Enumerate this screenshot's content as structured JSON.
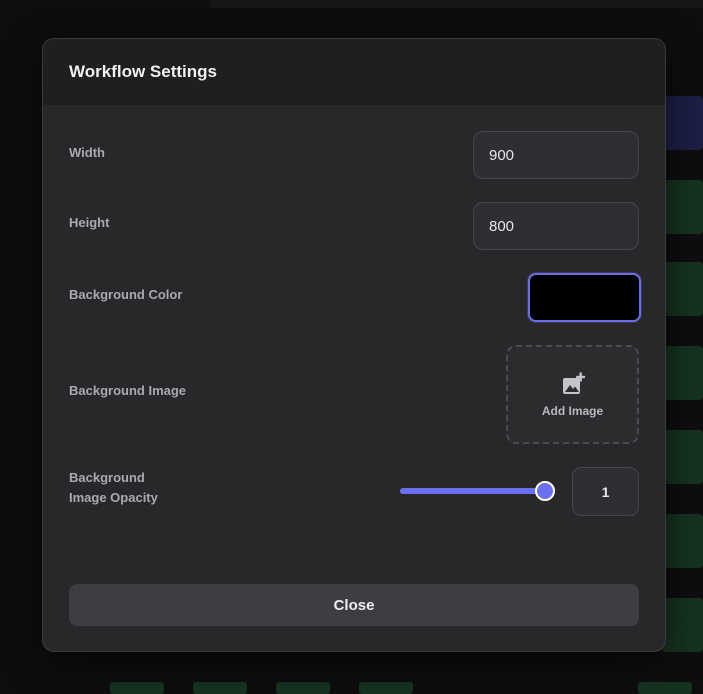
{
  "modal": {
    "title": "Workflow Settings",
    "width": {
      "label": "Width",
      "value": "900"
    },
    "height": {
      "label": "Height",
      "value": "800"
    },
    "background_color": {
      "label": "Background Color",
      "value": "#000000"
    },
    "background_image": {
      "label": "Background Image",
      "button_label": "Add Image",
      "icon": "add-photo-icon"
    },
    "opacity": {
      "label_line1": "Background",
      "label_line2": "Image Opacity",
      "value": "1",
      "level": 1.0
    },
    "close_label": "Close"
  },
  "colors": {
    "accent": "#6c6ff0",
    "modal_bg": "#28282b",
    "header_bg": "#1f1f21"
  }
}
